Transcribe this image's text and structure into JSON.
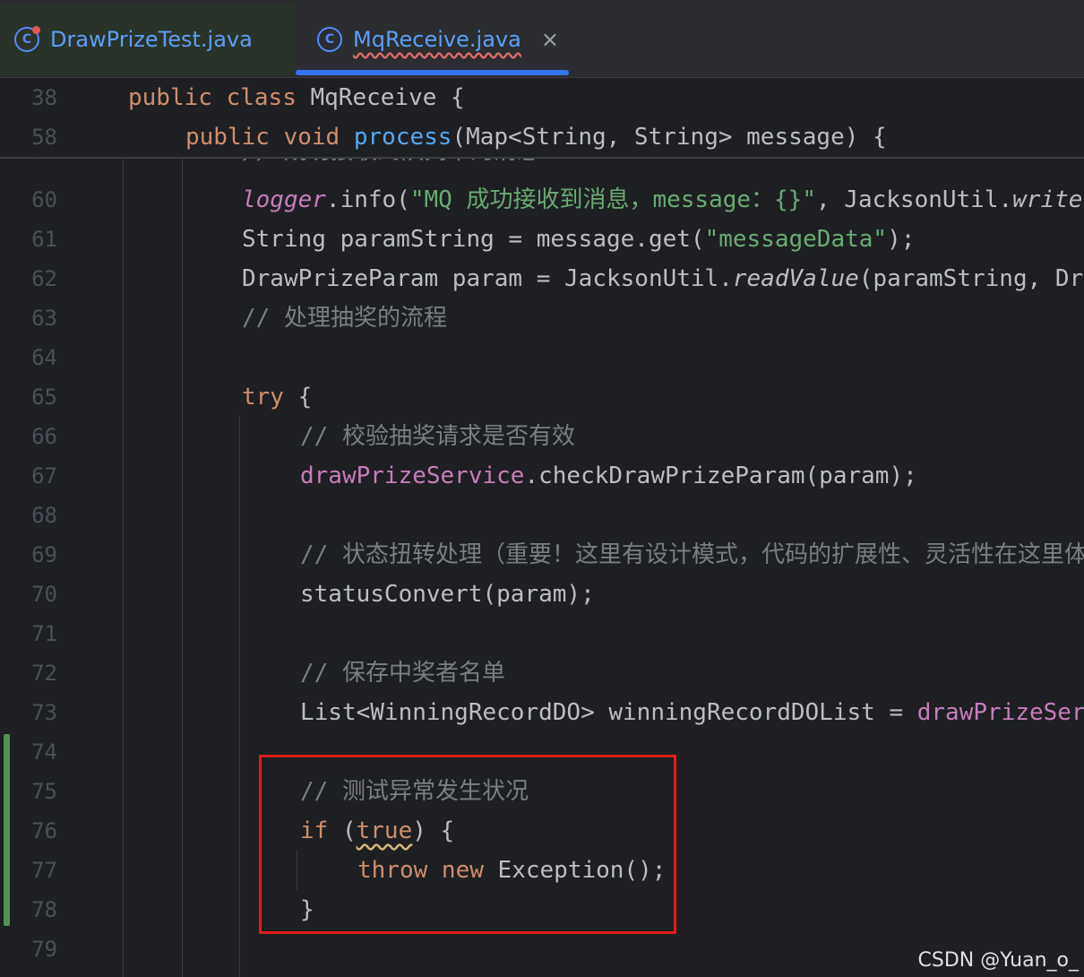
{
  "tabs": [
    {
      "label": "DrawPrizeTest.java",
      "active": false,
      "icon": "class-icon-modified"
    },
    {
      "label": "MqReceive.java",
      "active": true,
      "icon": "class-icon",
      "close": "×"
    }
  ],
  "sticky_lines": [
    {
      "num": "38",
      "tokens": [
        [
          "kw",
          "public "
        ],
        [
          "kw",
          "class "
        ],
        [
          "",
          "MqReceive {"
        ]
      ]
    },
    {
      "num": "58",
      "tokens": [
        [
          "kw",
          "public "
        ],
        [
          "kw",
          "void "
        ],
        [
          "fn",
          "process"
        ],
        [
          "",
          "(Map<String, String> message) {"
        ]
      ]
    }
  ],
  "lines": [
    {
      "num": "59",
      "tokens": [
        [
          "cmt",
          "// 成功接收到队列中的消息"
        ]
      ]
    },
    {
      "num": "60",
      "tokens": [
        [
          "field italic",
          "logger"
        ],
        [
          "",
          ".info("
        ],
        [
          "str",
          "\"MQ 成功接收到消息，message：{}\""
        ],
        [
          "",
          ", JacksonUtil."
        ],
        [
          "italic",
          "writeValueAsString"
        ]
      ]
    },
    {
      "num": "61",
      "tokens": [
        [
          "",
          "String paramString = message.get("
        ],
        [
          "str",
          "\"messageData\""
        ],
        [
          "",
          ");"
        ]
      ]
    },
    {
      "num": "62",
      "tokens": [
        [
          "",
          "DrawPrizeParam param = JacksonUtil."
        ],
        [
          "italic",
          "readValue"
        ],
        [
          "",
          "(paramString, DrawPrizeParam.class);"
        ]
      ]
    },
    {
      "num": "63",
      "tokens": [
        [
          "cmt",
          "// 处理抽奖的流程"
        ]
      ]
    },
    {
      "num": "64",
      "tokens": []
    },
    {
      "num": "65",
      "tokens": [
        [
          "kw",
          "try "
        ],
        [
          "",
          "{"
        ]
      ]
    },
    {
      "num": "66",
      "tokens": [
        [
          "cmt",
          "// 校验抽奖请求是否有效"
        ]
      ]
    },
    {
      "num": "67",
      "tokens": [
        [
          "field",
          "drawPrizeService"
        ],
        [
          "",
          ".checkDrawPrizeParam(param);"
        ]
      ]
    },
    {
      "num": "68",
      "tokens": []
    },
    {
      "num": "69",
      "tokens": [
        [
          "cmt",
          "// 状态扭转处理（重要！这里有设计模式，代码的扩展性、灵活性在这里体现）"
        ]
      ]
    },
    {
      "num": "70",
      "tokens": [
        [
          "",
          "statusConvert(param);"
        ]
      ]
    },
    {
      "num": "71",
      "tokens": []
    },
    {
      "num": "72",
      "tokens": [
        [
          "cmt",
          "// 保存中奖者名单"
        ]
      ]
    },
    {
      "num": "73",
      "tokens": [
        [
          "",
          "List<WinningRecordDO> winningRecordDOList = "
        ],
        [
          "field",
          "drawPrizeService"
        ]
      ]
    },
    {
      "num": "74",
      "tokens": []
    },
    {
      "num": "75",
      "tokens": [
        [
          "cmt",
          "// 测试异常发生状况"
        ]
      ]
    },
    {
      "num": "76",
      "tokens": [
        [
          "kw",
          "if "
        ],
        [
          "",
          "("
        ],
        [
          "kw warn",
          "true"
        ],
        [
          "",
          ") {"
        ]
      ]
    },
    {
      "num": "77",
      "tokens": [
        [
          "kw",
          "throw "
        ],
        [
          "kw",
          "new "
        ],
        [
          "",
          "Exception();"
        ]
      ]
    },
    {
      "num": "78",
      "tokens": [
        [
          "",
          "}"
        ]
      ]
    },
    {
      "num": "79",
      "tokens": []
    }
  ],
  "watermark": "CSDN @Yuan_o_",
  "colors": {
    "background": "#1e1f22",
    "keyword": "#cf8e6d",
    "method": "#56a8f5",
    "field": "#c77dbb",
    "string": "#6aab73",
    "comment": "#7a7e85",
    "text": "#bcbec4",
    "highlight": "#e01b1b"
  }
}
